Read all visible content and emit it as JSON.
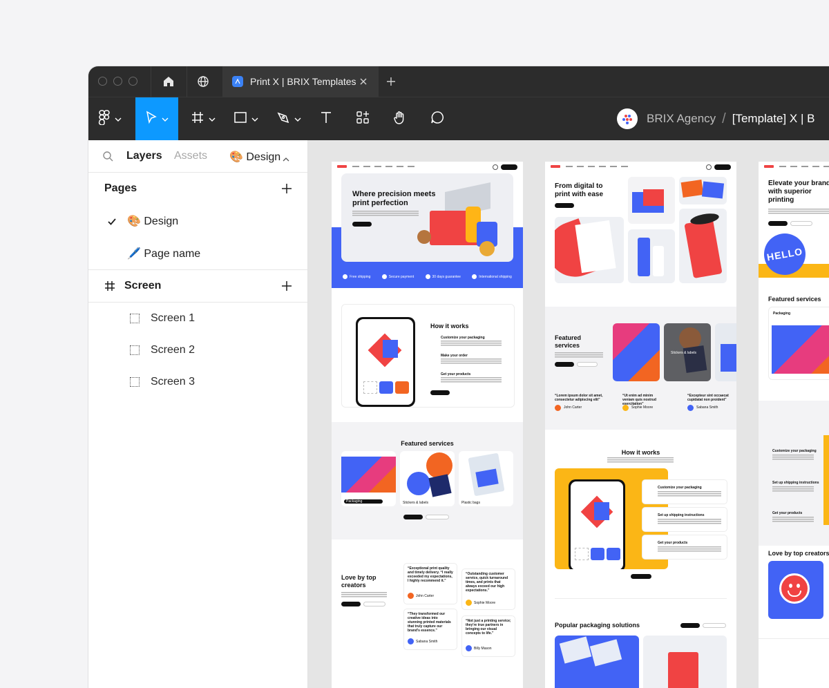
{
  "browser": {
    "tab_title": "Print X | BRIX Templates"
  },
  "toolbar": {
    "org_name": "BRIX Agency",
    "breadcrumb_separator": "/",
    "file_name": "[Template] X | B"
  },
  "sidebar": {
    "tabs": {
      "layers": "Layers",
      "assets": "Assets",
      "design": "🎨 Design"
    },
    "pages_title": "Pages",
    "pages": [
      {
        "label": "🎨 Design",
        "selected": true
      },
      {
        "label": "🖊️ Page name",
        "selected": false
      }
    ],
    "screen_title": "Screen",
    "layers": [
      "Screen 1",
      "Screen 2",
      "Screen 3"
    ]
  },
  "canvas": {
    "frame1": {
      "hero_title": "Where precision meets print perfection",
      "features": [
        "Free shipping",
        "Secure payment",
        "30 days guarantee",
        "International shipping"
      ],
      "how_title": "How it works",
      "steps": [
        "Customize your packaging",
        "Make your order",
        "Get your products"
      ],
      "featured_title": "Featured services",
      "services": [
        "Packaging",
        "Stickers & labels",
        "Plastic bags"
      ],
      "love_title": "Love by top creators",
      "testimonials": [
        {
          "quote": "“Exceptional print quality and timely delivery. “I really exceeded my expectations, I highly recommend it.”",
          "name": "John Carter"
        },
        {
          "quote": "“Outstanding customer service, quick turnaround times, and prints that always exceed our high expectations.”",
          "name": "Sophie Moore"
        },
        {
          "quote": "“They transformed our creative ideas into stunning printed materials that truly capture our brand's essence.”",
          "name": "Sabana Smith"
        },
        {
          "quote": "“Not just a printing service; they're true partners in bringing our visual concepts to life.”",
          "name": "Billy Mason"
        }
      ]
    },
    "frame2": {
      "hero_title": "From digital to print with ease",
      "featured_title": "Featured services",
      "service_card": "Stickers & labels",
      "quotes": [
        {
          "quote": "“Lorem ipsum dolor sit amet, consectetur adipiscing elit”",
          "name": "John Carter"
        },
        {
          "quote": "“Ut enim ad minim veniam quis nostrud exercitation”",
          "name": "Sophie Moore"
        },
        {
          "quote": "“Excepteur sint occaecat cupidatat non proident”",
          "name": "Sabana Smith"
        }
      ],
      "how_title": "How it works",
      "steps": [
        "Customize your packaging",
        "Set up shipping instructions",
        "Get your products"
      ],
      "popular_title": "Popular packaging solutions"
    },
    "frame3": {
      "hero_title": "Elevate your brand with superior printing",
      "hello_text": "HELLO",
      "featured_title": "Featured services",
      "service": "Packaging",
      "steps": [
        "Customize your packaging",
        "Set up shipping instructions",
        "Get your products"
      ],
      "love_title": "Love by top creators"
    }
  },
  "colors": {
    "accent_blue": "#0d99ff",
    "brand_blue": "#4263f5",
    "brand_orange": "#f26522",
    "brand_yellow": "#fbb616",
    "dark_chrome": "#2c2c2c"
  }
}
